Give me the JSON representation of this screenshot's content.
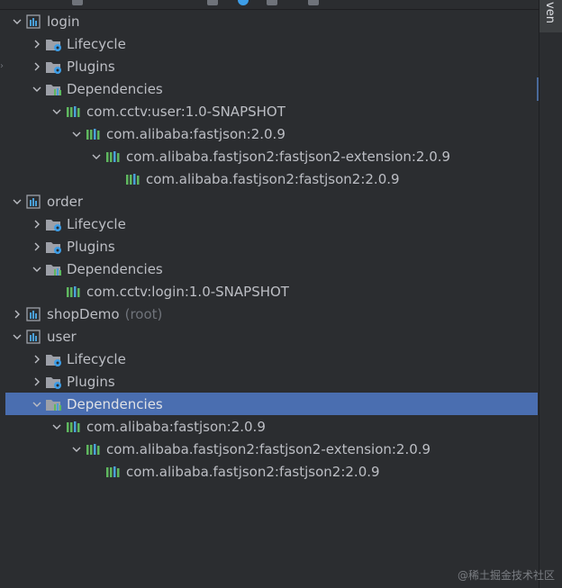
{
  "sidebar_tab": {
    "label": "ven"
  },
  "tree": [
    {
      "label": "login",
      "type": "module",
      "expanded": true,
      "depth": 0
    },
    {
      "label": "Lifecycle",
      "type": "lifecycle",
      "expanded": false,
      "depth": 1
    },
    {
      "label": "Plugins",
      "type": "plugins",
      "expanded": false,
      "depth": 1
    },
    {
      "label": "Dependencies",
      "type": "dependencies",
      "expanded": true,
      "depth": 1
    },
    {
      "label": "com.cctv:user:1.0-SNAPSHOT",
      "type": "library",
      "expanded": true,
      "depth": 2
    },
    {
      "label": "com.alibaba:fastjson:2.0.9",
      "type": "library",
      "expanded": true,
      "depth": 3
    },
    {
      "label": "com.alibaba.fastjson2:fastjson2-extension:2.0.9",
      "type": "library",
      "expanded": true,
      "depth": 4
    },
    {
      "label": "com.alibaba.fastjson2:fastjson2:2.0.9",
      "type": "library",
      "leaf": true,
      "depth": 5
    },
    {
      "label": "order",
      "type": "module",
      "expanded": true,
      "depth": 0
    },
    {
      "label": "Lifecycle",
      "type": "lifecycle",
      "expanded": false,
      "depth": 1
    },
    {
      "label": "Plugins",
      "type": "plugins",
      "expanded": false,
      "depth": 1
    },
    {
      "label": "Dependencies",
      "type": "dependencies",
      "expanded": true,
      "depth": 1
    },
    {
      "label": "com.cctv:login:1.0-SNAPSHOT",
      "type": "library",
      "leaf": true,
      "depth": 2
    },
    {
      "label": "shopDemo",
      "suffix": "(root)",
      "type": "module",
      "expanded": false,
      "depth": 0
    },
    {
      "label": "user",
      "type": "module",
      "expanded": true,
      "depth": 0
    },
    {
      "label": "Lifecycle",
      "type": "lifecycle",
      "expanded": false,
      "depth": 1
    },
    {
      "label": "Plugins",
      "type": "plugins",
      "expanded": false,
      "depth": 1
    },
    {
      "label": "Dependencies",
      "type": "dependencies",
      "expanded": true,
      "depth": 1,
      "selected": true
    },
    {
      "label": "com.alibaba:fastjson:2.0.9",
      "type": "library",
      "expanded": true,
      "depth": 2
    },
    {
      "label": "com.alibaba.fastjson2:fastjson2-extension:2.0.9",
      "type": "library",
      "expanded": true,
      "depth": 3
    },
    {
      "label": "com.alibaba.fastjson2:fastjson2:2.0.9",
      "type": "library",
      "leaf": true,
      "depth": 4
    }
  ],
  "watermark": "@稀土掘金技术社区",
  "colors": {
    "background": "#2b2d30",
    "selection": "#4a6eb0",
    "text": "#bcbec4",
    "muted": "#6f737a",
    "lib_green": "#5fb85f",
    "lib_blue": "#4a9fd8",
    "gear_blue": "#3d9ee8"
  }
}
